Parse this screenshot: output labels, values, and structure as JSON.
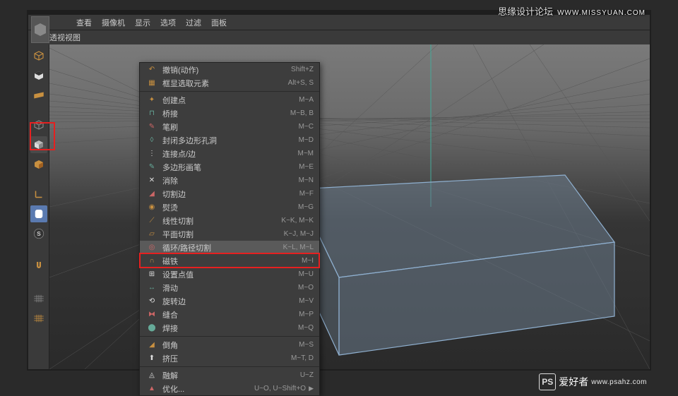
{
  "watermark": {
    "top_cn": "思缘设计论坛",
    "top_en": "WWW.MISSYUAN.COM",
    "bottom_cn": "爱好者",
    "bottom_url": "www.psahz.com",
    "ps": "PS"
  },
  "topmenu": {
    "items": [
      "查看",
      "摄像机",
      "显示",
      "选项",
      "过滤",
      "面板"
    ]
  },
  "subbar": {
    "label": "透视视图"
  },
  "context": {
    "items": [
      {
        "icon": "↶",
        "label": "撤销(动作)",
        "shortcut": "Shift+Z"
      },
      {
        "icon": "▦",
        "label": "框显选取元素",
        "shortcut": "Alt+S, S"
      },
      {
        "sep": true
      },
      {
        "icon": "✦",
        "label": "创建点",
        "shortcut": "M~A"
      },
      {
        "icon": "⊓",
        "label": "桥接",
        "shortcut": "M~B, B"
      },
      {
        "icon": "✎",
        "label": "笔刷",
        "shortcut": "M~C"
      },
      {
        "icon": "◊",
        "label": "封闭多边形孔洞",
        "shortcut": "M~D"
      },
      {
        "icon": "⋮",
        "label": "连接点/边",
        "shortcut": "M~M"
      },
      {
        "icon": "✎",
        "label": "多边形画笔",
        "shortcut": "M~E"
      },
      {
        "icon": "✕",
        "label": "消除",
        "shortcut": "M~N"
      },
      {
        "icon": "◢",
        "label": "切割边",
        "shortcut": "M~F"
      },
      {
        "icon": "◉",
        "label": "熨烫",
        "shortcut": "M~G"
      },
      {
        "icon": "⟋",
        "label": "线性切割",
        "shortcut": "K~K, M~K"
      },
      {
        "icon": "▱",
        "label": "平面切割",
        "shortcut": "K~J, M~J"
      },
      {
        "icon": "◎",
        "label": "循环/路径切割",
        "shortcut": "K~L, M~L",
        "hl": true
      },
      {
        "icon": "∩",
        "label": "磁铁",
        "shortcut": "M~I"
      },
      {
        "icon": "⊞",
        "label": "设置点值",
        "shortcut": "M~U"
      },
      {
        "icon": "↔",
        "label": "滑动",
        "shortcut": "M~O"
      },
      {
        "icon": "⟲",
        "label": "旋转边",
        "shortcut": "M~V"
      },
      {
        "icon": "⧓",
        "label": "缝合",
        "shortcut": "M~P"
      },
      {
        "icon": "⬤",
        "label": "焊接",
        "shortcut": "M~Q"
      },
      {
        "sep": true
      },
      {
        "icon": "◢",
        "label": "倒角",
        "shortcut": "M~S"
      },
      {
        "icon": "⬆",
        "label": "挤压",
        "shortcut": "M~T, D"
      },
      {
        "sep": true
      },
      {
        "icon": "◬",
        "label": "融解",
        "shortcut": "U~Z"
      },
      {
        "icon": "▲",
        "label": "优化...",
        "shortcut": "U~O, U~Shift+O",
        "arrow": true
      }
    ]
  }
}
